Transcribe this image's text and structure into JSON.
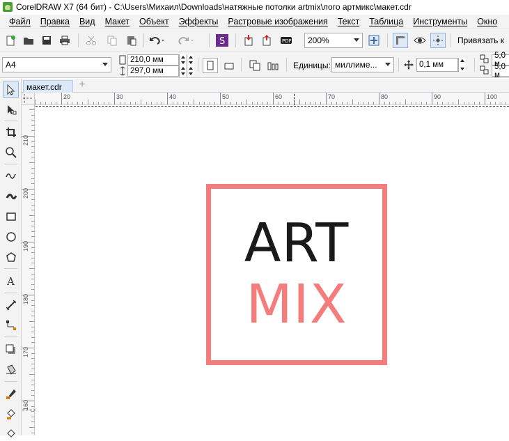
{
  "title_bar": {
    "text": "CorelDRAW X7 (64 бит) - C:\\Users\\Михаил\\Downloads\\натяжные потолки artmix\\лого артмикс\\макет.cdr"
  },
  "menu": {
    "items": [
      "Файл",
      "Правка",
      "Вид",
      "Макет",
      "Объект",
      "Эффекты",
      "Растровые изображения",
      "Текст",
      "Таблица",
      "Инструменты",
      "Окно"
    ]
  },
  "toolbar": {
    "zoom_value": "200%",
    "snap_label": "Привязать к"
  },
  "property_bar": {
    "page_size": "A4",
    "width": "210,0 мм",
    "height": "297,0 мм",
    "units_label": "Единицы:",
    "units_value": "миллиме...",
    "nudge": "0,1 мм",
    "dup_x": "5,0 м",
    "dup_y": "5,0 м"
  },
  "document_tab": {
    "name": "макет.cdr",
    "add_symbol": "+"
  },
  "rulers": {
    "horizontal": [
      "20",
      "30",
      "40",
      "50",
      "60",
      "70",
      "80",
      "90",
      "100"
    ],
    "vertical": [
      "210",
      "200",
      "190",
      "180",
      "170",
      "160"
    ]
  },
  "canvas": {
    "logo_line1": "ART",
    "logo_line2": "MIX",
    "colors": {
      "frame": "#f47c7c",
      "art_text": "#1a1a1a",
      "mix_text": "#f47c7c"
    }
  },
  "icons": {
    "toolbar": [
      "new-document-icon",
      "open-icon",
      "save-icon",
      "print-icon",
      "cut-icon",
      "copy-icon",
      "paste-icon",
      "undo-icon",
      "redo-icon",
      "search-content-icon",
      "import-icon",
      "export-icon",
      "publish-pdf-icon",
      "zoom-to-page-icon",
      "full-screen-icon",
      "show-rulers-icon",
      "show-grid-icon",
      "show-guidelines-icon"
    ],
    "toolbox": [
      "pick-tool-icon",
      "shape-tool-icon",
      "crop-tool-icon",
      "zoom-tool-icon",
      "freehand-tool-icon",
      "artistic-media-icon",
      "rectangle-tool-icon",
      "ellipse-tool-icon",
      "polygon-tool-icon",
      "text-tool-icon",
      "parallel-dimension-icon",
      "connector-tool-icon",
      "drop-shadow-icon",
      "transparency-icon",
      "eyedropper-icon",
      "interactive-fill-icon",
      "smart-fill-icon"
    ]
  }
}
